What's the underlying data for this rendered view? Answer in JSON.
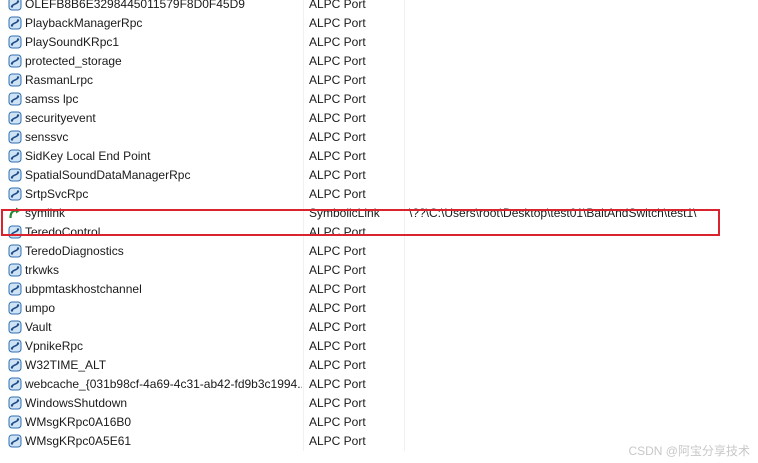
{
  "rows": [
    {
      "name": "OLEFB8B6E3298445011579F8D0F45D9",
      "type": "ALPC Port",
      "target": "",
      "icon": "alpc-port-icon"
    },
    {
      "name": "PlaybackManagerRpc",
      "type": "ALPC Port",
      "target": "",
      "icon": "alpc-port-icon"
    },
    {
      "name": "PlaySoundKRpc1",
      "type": "ALPC Port",
      "target": "",
      "icon": "alpc-port-icon"
    },
    {
      "name": "protected_storage",
      "type": "ALPC Port",
      "target": "",
      "icon": "alpc-port-icon"
    },
    {
      "name": "RasmanLrpc",
      "type": "ALPC Port",
      "target": "",
      "icon": "alpc-port-icon"
    },
    {
      "name": "samss lpc",
      "type": "ALPC Port",
      "target": "",
      "icon": "alpc-port-icon"
    },
    {
      "name": "securityevent",
      "type": "ALPC Port",
      "target": "",
      "icon": "alpc-port-icon"
    },
    {
      "name": "senssvc",
      "type": "ALPC Port",
      "target": "",
      "icon": "alpc-port-icon"
    },
    {
      "name": "SidKey Local End Point",
      "type": "ALPC Port",
      "target": "",
      "icon": "alpc-port-icon"
    },
    {
      "name": "SpatialSoundDataManagerRpc",
      "type": "ALPC Port",
      "target": "",
      "icon": "alpc-port-icon"
    },
    {
      "name": "SrtpSvcRpc",
      "type": "ALPC Port",
      "target": "",
      "icon": "alpc-port-icon"
    },
    {
      "name": "symlink",
      "type": "SymbolicLink",
      "target": "\\??\\C:\\Users\\root\\Desktop\\test01\\BaitAndSwitch\\test1\\",
      "icon": "symlink-arrow-icon"
    },
    {
      "name": "TeredoControl",
      "type": "ALPC Port",
      "target": "",
      "icon": "alpc-port-icon"
    },
    {
      "name": "TeredoDiagnostics",
      "type": "ALPC Port",
      "target": "",
      "icon": "alpc-port-icon"
    },
    {
      "name": "trkwks",
      "type": "ALPC Port",
      "target": "",
      "icon": "alpc-port-icon"
    },
    {
      "name": "ubpmtaskhostchannel",
      "type": "ALPC Port",
      "target": "",
      "icon": "alpc-port-icon"
    },
    {
      "name": "umpo",
      "type": "ALPC Port",
      "target": "",
      "icon": "alpc-port-icon"
    },
    {
      "name": "Vault",
      "type": "ALPC Port",
      "target": "",
      "icon": "alpc-port-icon"
    },
    {
      "name": "VpnikeRpc",
      "type": "ALPC Port",
      "target": "",
      "icon": "alpc-port-icon"
    },
    {
      "name": "W32TIME_ALT",
      "type": "ALPC Port",
      "target": "",
      "icon": "alpc-port-icon"
    },
    {
      "name": "webcache_{031b98cf-4a69-4c31-ab42-fd9b3c1994...",
      "type": "ALPC Port",
      "target": "",
      "icon": "alpc-port-icon"
    },
    {
      "name": "WindowsShutdown",
      "type": "ALPC Port",
      "target": "",
      "icon": "alpc-port-icon"
    },
    {
      "name": "WMsgKRpc0A16B0",
      "type": "ALPC Port",
      "target": "",
      "icon": "alpc-port-icon"
    },
    {
      "name": "WMsgKRpc0A5E61",
      "type": "ALPC Port",
      "target": "",
      "icon": "alpc-port-icon"
    }
  ],
  "highlight_color": "#d9232e",
  "watermark": "CSDN @阿宝分享技术"
}
